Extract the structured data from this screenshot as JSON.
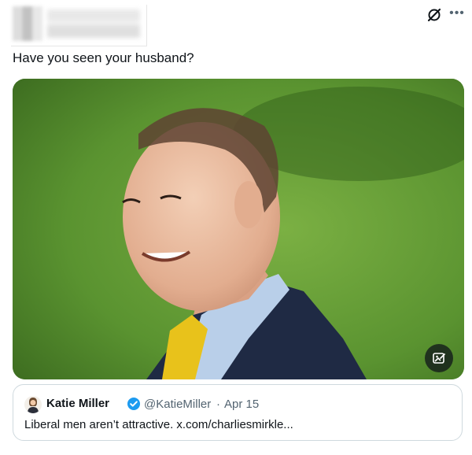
{
  "tweet": {
    "text": "Have you seen your husband?"
  },
  "icons": {
    "grok": "grok-icon",
    "more": "more-icon",
    "alt": "edit-image-icon",
    "verified": "verified-badge-icon"
  },
  "quote": {
    "name": "Katie Miller",
    "handle": "@KatieMiller",
    "separator": "·",
    "date": "Apr 15",
    "text": "Liberal men aren’t attractive. x.com/charliesmirkle..."
  },
  "colors": {
    "verified_blue": "#1d9bf0",
    "secondary_text": "#536471",
    "border": "#cfd9de"
  }
}
